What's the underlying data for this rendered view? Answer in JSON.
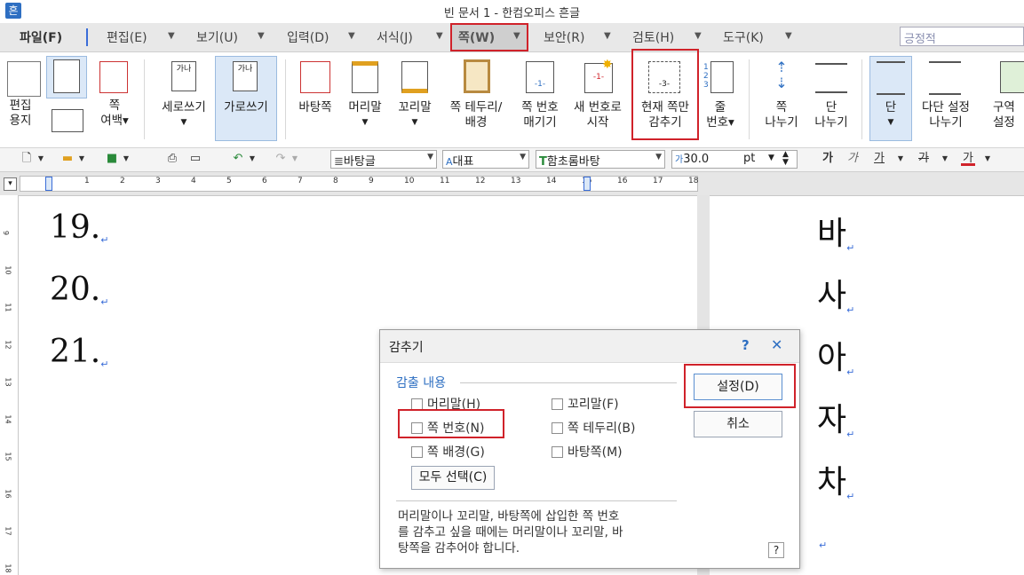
{
  "window": {
    "title": "빈 문서 1 - 한컴오피스 흔글",
    "app_icon": "흔"
  },
  "menu": {
    "items": [
      "파일(F)",
      "편집(E)",
      "보기(U)",
      "입력(D)",
      "서식(J)",
      "쪽(W)",
      "보안(R)",
      "검토(H)",
      "도구(K)"
    ],
    "search_placeholder": "긍정적"
  },
  "ribbon": {
    "edit_paper": [
      "편집",
      "용지"
    ],
    "margin": [
      "쪽",
      "여백▾"
    ],
    "vertical_write": "세로쓰기",
    "horizontal_write": "가로쓰기",
    "icon_ga": "가나",
    "icon_na": "나",
    "master_page": "바탕쪽",
    "header": "머리말",
    "footer": "꼬리말",
    "border": [
      "쪽 테두리/",
      "배경"
    ],
    "page_num": [
      "쪽 번호",
      "매기기"
    ],
    "new_num": [
      "새 번호로",
      "시작"
    ],
    "hide_current": [
      "현재 쪽만",
      "감추기"
    ],
    "line_num": [
      "줄",
      "번호▾"
    ],
    "page_break": [
      "쪽",
      "나누기"
    ],
    "col_break": [
      "단",
      "나누기"
    ],
    "column": "단",
    "multi_col": [
      "다단 설정",
      "나누기"
    ],
    "section": [
      "구역",
      "설정"
    ],
    "pagenum_icon": "-1-",
    "newnum_icon": "-1-",
    "hide_icon": "-3-",
    "linenum_icon": [
      "1",
      "2",
      "3"
    ]
  },
  "toolbar": {
    "style": "바탕글",
    "lang": "대표",
    "lang_icon": "A",
    "font": "함초롬바탕",
    "font_icon": "T",
    "size_icon": "가",
    "size": "30.0",
    "unit": "pt",
    "bold": "가",
    "italic": "가",
    "underline": "가",
    "strike": "가",
    "color": "가"
  },
  "ruler": {
    "numbers": [
      "1",
      "2",
      "3",
      "4",
      "5",
      "6",
      "7",
      "8",
      "9",
      "10",
      "11",
      "12",
      "13",
      "14",
      "15",
      "16",
      "17",
      "18"
    ],
    "vnumbers": [
      "9",
      "10",
      "11",
      "12",
      "13",
      "14",
      "15",
      "16",
      "17",
      "18"
    ]
  },
  "document": {
    "left_lines": [
      "19.",
      "20.",
      "21."
    ],
    "right_lines": [
      "바",
      "사",
      "아",
      "자",
      "차"
    ],
    "return_mark": "↵"
  },
  "dialog": {
    "title": "감추기",
    "help": "?",
    "close": "✕",
    "group_label": "감출 내용",
    "options": [
      {
        "label": "머리말(H)",
        "checked": false
      },
      {
        "label": "꼬리말(F)",
        "checked": false
      },
      {
        "label": "쪽 번호(N)",
        "checked": false
      },
      {
        "label": "쪽 테두리(B)",
        "checked": false
      },
      {
        "label": "쪽 배경(G)",
        "checked": false
      },
      {
        "label": "바탕쪽(M)",
        "checked": false
      }
    ],
    "select_all": "모두 선택(C)",
    "ok": "설정(D)",
    "cancel": "취소",
    "note": [
      "머리말이나 꼬리말, 바탕쪽에 삽입한 쪽 번호",
      "를 감추고 싶을 때에는 머리말이나 꼬리말, 바",
      "탕쪽을 감추어야 합니다."
    ],
    "note_help": "?"
  },
  "colors": {
    "highlight": "#d0222a",
    "accent": "#2e6fc2",
    "selected": "#dbe8f7"
  }
}
